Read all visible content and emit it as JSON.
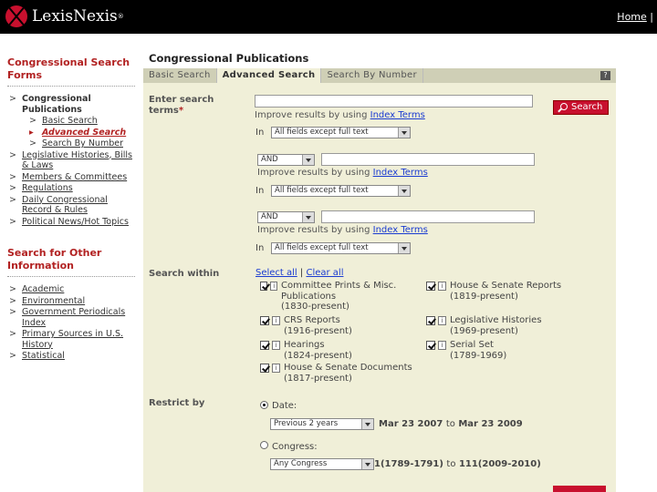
{
  "header": {
    "logo_text": "LexisNexis",
    "logo_reg": "®",
    "links": [
      "Home",
      "|"
    ]
  },
  "sidebar": {
    "heading1": "Congressional Search Forms",
    "items1": [
      {
        "label": "Congressional Publications",
        "children": [
          "Basic Search",
          "Advanced Search",
          "Search By Number"
        ]
      },
      {
        "label": "Legislative Histories, Bills & Laws"
      },
      {
        "label": "Members & Committees"
      },
      {
        "label": "Regulations"
      },
      {
        "label": "Daily Congressional Record & Rules"
      },
      {
        "label": "Political News/Hot Topics"
      }
    ],
    "heading2": "Search for Other Information",
    "items2": [
      "Academic",
      "Environmental",
      "Government Periodicals Index",
      "Primary Sources in U.S. History",
      "Statistical"
    ]
  },
  "main": {
    "title": "Congressional Publications",
    "tabs": [
      "Basic Search",
      "Advanced Search",
      "Search By Number"
    ],
    "help": "?",
    "enter_terms_label": "Enter search terms",
    "required_mark": "*",
    "search_button": "Search",
    "improve_text": "Improve results by using",
    "index_terms_link": "Index Terms",
    "in_label": "In",
    "field_select": "All fields except full text",
    "connector": "AND",
    "search_within_label": "Search within",
    "select_all": "Select all",
    "separator": "|",
    "clear_all": "Clear all",
    "sources": [
      {
        "name": "Committee Prints & Misc. Publications",
        "dates": "(1830-present)",
        "checked": true
      },
      {
        "name": "CRS Reports",
        "dates": "(1916-present)",
        "checked": true
      },
      {
        "name": "Hearings",
        "dates": "(1824-present)",
        "checked": true
      },
      {
        "name": "House & Senate Documents",
        "dates": "(1817-present)",
        "checked": true
      },
      {
        "name": "House & Senate Reports",
        "dates": "(1819-present)",
        "checked": true
      },
      {
        "name": "Legislative Histories",
        "dates": "(1969-present)",
        "checked": true
      },
      {
        "name": "Serial Set",
        "dates": "(1789-1969)",
        "checked": true
      }
    ],
    "info_glyph": "i",
    "restrict_label": "Restrict by",
    "date_label": "Date:",
    "date_select": "Previous 2 years",
    "date_from": "Mar 23 2007",
    "date_to_word": "to",
    "date_to": "Mar 23 2009",
    "congress_label": "Congress:",
    "congress_select": "Any Congress",
    "congress_from": "1(1789-1791)",
    "congress_to_word": "to",
    "congress_to": "111(2009-2010)"
  }
}
